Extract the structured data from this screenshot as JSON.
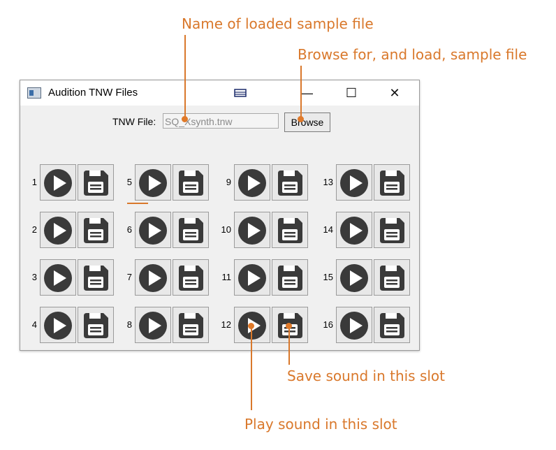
{
  "annotations": {
    "file_name": "Name of loaded sample file",
    "browse": "Browse for, and load, sample file",
    "save": "Save sound in this slot",
    "play": "Play sound in this slot"
  },
  "window": {
    "title": "Audition TNW Files",
    "minimize_glyph": "—",
    "maximize_glyph": "☐",
    "close_glyph": "✕"
  },
  "file_row": {
    "label": "TNW File:",
    "value": "SQ_Xsynth.tnw",
    "browse_label": "Browse"
  },
  "slots": [
    "1",
    "2",
    "3",
    "4",
    "5",
    "6",
    "7",
    "8",
    "9",
    "10",
    "11",
    "12",
    "13",
    "14",
    "15",
    "16"
  ],
  "icons": {
    "play": "play-icon",
    "save": "floppy-save-icon"
  },
  "colors": {
    "annotation": "#d9782b",
    "icon": "#3a3a3a"
  }
}
